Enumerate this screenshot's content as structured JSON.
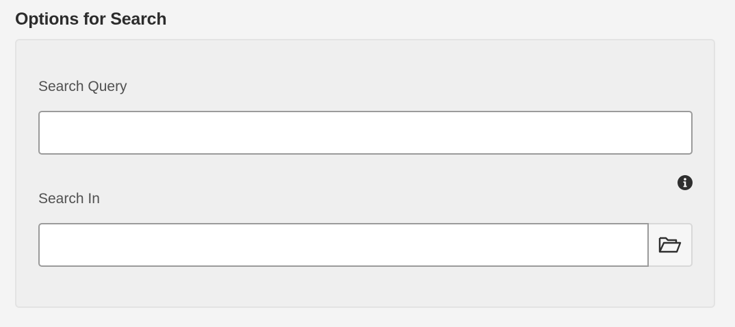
{
  "section": {
    "title": "Options for Search"
  },
  "fields": {
    "search_query": {
      "label": "Search Query",
      "value": "",
      "placeholder": ""
    },
    "search_in": {
      "label": "Search In",
      "value": "",
      "placeholder": ""
    }
  },
  "icons": {
    "info": "info-icon",
    "browse": "folder-open-icon"
  },
  "colors": {
    "background": "#f4f4f4",
    "panel": "#efefef",
    "text": "#2c2c2c",
    "label": "#505050",
    "input_border": "#9a9a9a"
  }
}
